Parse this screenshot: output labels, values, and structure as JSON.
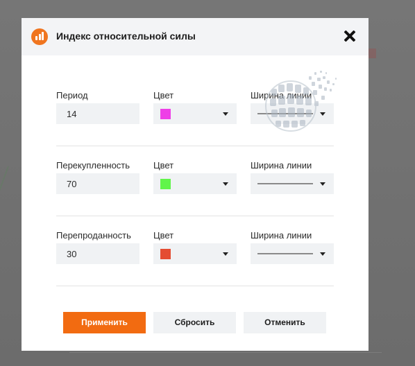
{
  "dialog": {
    "title": "Индекс относительной силы",
    "logo_icon": "bar-chart-icon",
    "close_icon": "close-icon"
  },
  "sections": [
    {
      "label": "Период",
      "value": "14",
      "color_label": "Цвет",
      "color": "#ee3fe7",
      "width_label": "Ширина линии"
    },
    {
      "label": "Перекупленность",
      "value": "70",
      "color_label": "Цвет",
      "color": "#61f54a",
      "width_label": "Ширина линии"
    },
    {
      "label": "Перепроданность",
      "value": "30",
      "color_label": "Цвет",
      "color": "#e44d32",
      "width_label": "Ширина линии"
    }
  ],
  "buttons": {
    "apply": "Применить",
    "reset": "Сбросить",
    "cancel": "Отменить"
  },
  "colors": {
    "accent": "#f26b11",
    "header_bg": "#f3f4f6",
    "field_bg": "#f0f2f4"
  }
}
